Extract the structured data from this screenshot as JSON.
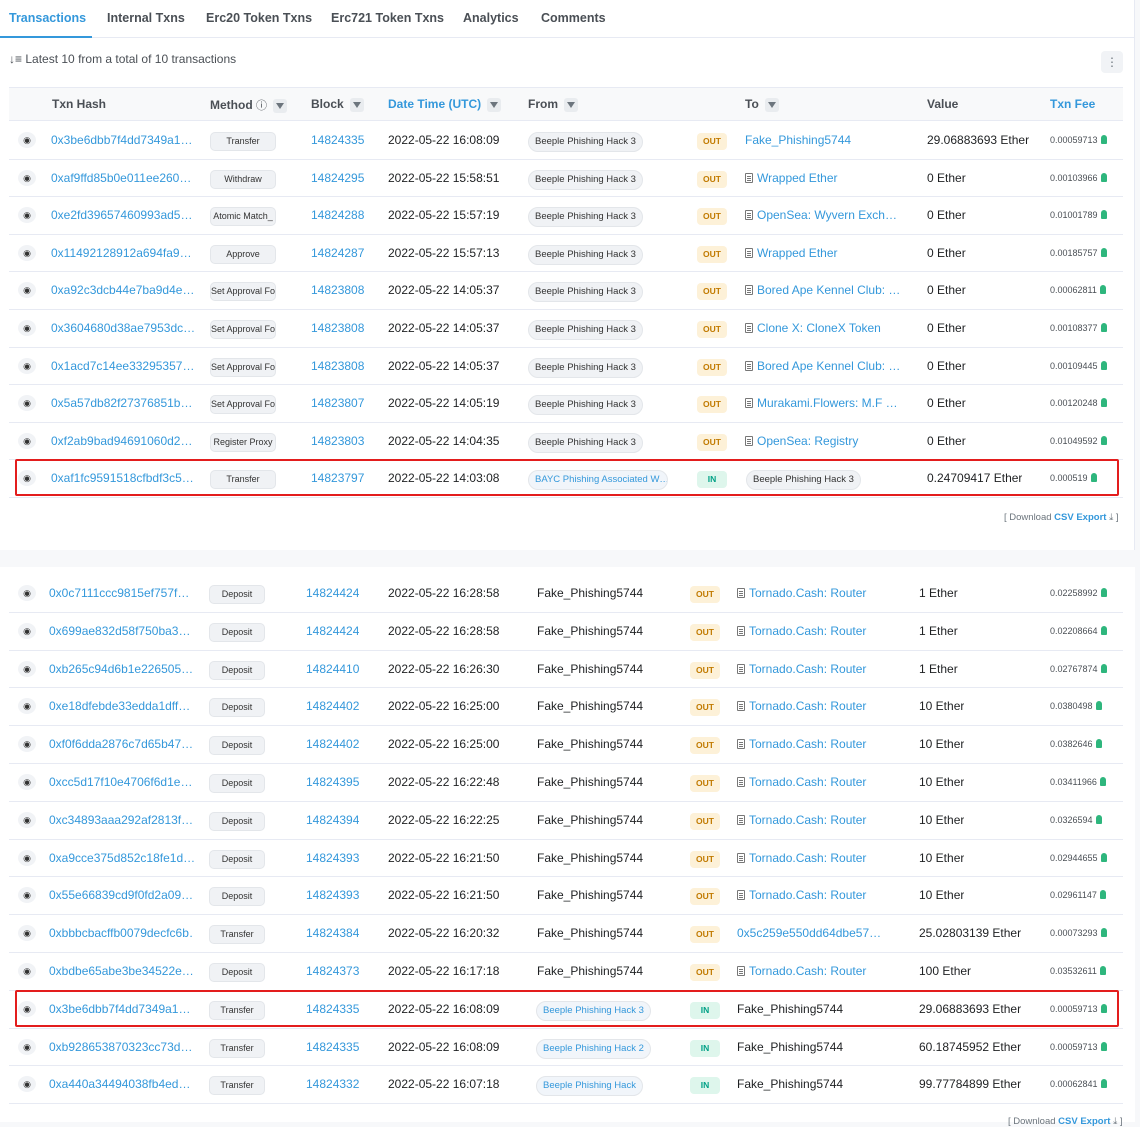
{
  "tabs": [
    "Transactions",
    "Internal Txns",
    "Erc20 Token Txns",
    "Erc721 Token Txns",
    "Analytics",
    "Comments"
  ],
  "summary": "Latest 10 from a total of 10 transactions",
  "headers": {
    "hash": "Txn Hash",
    "method": "Method",
    "block": "Block",
    "date": "Date Time (UTC)",
    "from": "From",
    "to": "To",
    "value": "Value",
    "fee": "Txn Fee"
  },
  "csv": {
    "prefix": "[ Download ",
    "link": "CSV Export",
    "suffix": " ]"
  },
  "table1": [
    {
      "hash": "0x3be6dbb7f4dd7349a1…",
      "method": "Transfer",
      "block": "14824335",
      "date": "2022-05-22 16:08:09",
      "from": "Beeple Phishing Hack 3",
      "dir": "OUT",
      "to": "Fake_Phishing5744",
      "to_contract": false,
      "to_link": true,
      "value": "29.06883693 Ether",
      "fee": "0.00059713"
    },
    {
      "hash": "0xaf9ffd85b0e011ee260…",
      "method": "Withdraw",
      "block": "14824295",
      "date": "2022-05-22 15:58:51",
      "from": "Beeple Phishing Hack 3",
      "dir": "OUT",
      "to": "Wrapped Ether",
      "to_contract": true,
      "to_link": true,
      "value": "0 Ether",
      "fee": "0.00103966"
    },
    {
      "hash": "0xe2fd39657460993ad5…",
      "method": "Atomic Match_",
      "block": "14824288",
      "date": "2022-05-22 15:57:19",
      "from": "Beeple Phishing Hack 3",
      "dir": "OUT",
      "to": "OpenSea: Wyvern Exch…",
      "to_contract": true,
      "to_link": true,
      "value": "0 Ether",
      "fee": "0.01001789"
    },
    {
      "hash": "0x11492128912a694fa9…",
      "method": "Approve",
      "block": "14824287",
      "date": "2022-05-22 15:57:13",
      "from": "Beeple Phishing Hack 3",
      "dir": "OUT",
      "to": "Wrapped Ether",
      "to_contract": true,
      "to_link": true,
      "value": "0 Ether",
      "fee": "0.00185757"
    },
    {
      "hash": "0xa92c3dcb44e7ba9d4e…",
      "method": "Set Approval For…",
      "block": "14823808",
      "date": "2022-05-22 14:05:37",
      "from": "Beeple Phishing Hack 3",
      "dir": "OUT",
      "to": "Bored Ape Kennel Club: …",
      "to_contract": true,
      "to_link": true,
      "value": "0 Ether",
      "fee": "0.00062811"
    },
    {
      "hash": "0x3604680d38ae7953dc…",
      "method": "Set Approval For…",
      "block": "14823808",
      "date": "2022-05-22 14:05:37",
      "from": "Beeple Phishing Hack 3",
      "dir": "OUT",
      "to": "Clone X: CloneX Token",
      "to_contract": true,
      "to_link": true,
      "value": "0 Ether",
      "fee": "0.00108377"
    },
    {
      "hash": "0x1acd7c14ee33295357…",
      "method": "Set Approval For…",
      "block": "14823808",
      "date": "2022-05-22 14:05:37",
      "from": "Beeple Phishing Hack 3",
      "dir": "OUT",
      "to": "Bored Ape Kennel Club: …",
      "to_contract": true,
      "to_link": true,
      "value": "0 Ether",
      "fee": "0.00109445"
    },
    {
      "hash": "0x5a57db82f27376851b…",
      "method": "Set Approval For…",
      "block": "14823807",
      "date": "2022-05-22 14:05:19",
      "from": "Beeple Phishing Hack 3",
      "dir": "OUT",
      "to": "Murakami.Flowers: M.F …",
      "to_contract": true,
      "to_link": true,
      "value": "0 Ether",
      "fee": "0.00120248"
    },
    {
      "hash": "0xf2ab9bad94691060d2…",
      "method": "Register Proxy",
      "block": "14823803",
      "date": "2022-05-22 14:04:35",
      "from": "Beeple Phishing Hack 3",
      "dir": "OUT",
      "to": "OpenSea: Registry",
      "to_contract": true,
      "to_link": true,
      "value": "0 Ether",
      "fee": "0.01049592"
    },
    {
      "hash": "0xaf1fc9591518cfbdf3c5…",
      "method": "Transfer",
      "block": "14823797",
      "date": "2022-05-22 14:03:08",
      "from": "BAYC Phishing Associated W…",
      "from_blue": true,
      "dir": "IN",
      "to": "Beeple Phishing Hack 3",
      "to_tag": true,
      "value": "0.24709417 Ether",
      "fee": "0.000519"
    }
  ],
  "table2": [
    {
      "hash": "0x0c7111ccc9815ef757f…",
      "method": "Deposit",
      "block": "14824424",
      "date": "2022-05-22 16:28:58",
      "from": "Fake_Phishing5744",
      "dir": "OUT",
      "to": "Tornado.Cash: Router",
      "to_contract": true,
      "to_link": true,
      "value": "1 Ether",
      "fee": "0.02258992"
    },
    {
      "hash": "0x699ae832d58f750ba3…",
      "method": "Deposit",
      "block": "14824424",
      "date": "2022-05-22 16:28:58",
      "from": "Fake_Phishing5744",
      "dir": "OUT",
      "to": "Tornado.Cash: Router",
      "to_contract": true,
      "to_link": true,
      "value": "1 Ether",
      "fee": "0.02208664"
    },
    {
      "hash": "0xb265c94d6b1e226505…",
      "method": "Deposit",
      "block": "14824410",
      "date": "2022-05-22 16:26:30",
      "from": "Fake_Phishing5744",
      "dir": "OUT",
      "to": "Tornado.Cash: Router",
      "to_contract": true,
      "to_link": true,
      "value": "1 Ether",
      "fee": "0.02767874"
    },
    {
      "hash": "0xe18dfebde33edda1dff…",
      "method": "Deposit",
      "block": "14824402",
      "date": "2022-05-22 16:25:00",
      "from": "Fake_Phishing5744",
      "dir": "OUT",
      "to": "Tornado.Cash: Router",
      "to_contract": true,
      "to_link": true,
      "value": "10 Ether",
      "fee": "0.0380498"
    },
    {
      "hash": "0xf0f6dda2876c7d65b47…",
      "method": "Deposit",
      "block": "14824402",
      "date": "2022-05-22 16:25:00",
      "from": "Fake_Phishing5744",
      "dir": "OUT",
      "to": "Tornado.Cash: Router",
      "to_contract": true,
      "to_link": true,
      "value": "10 Ether",
      "fee": "0.0382646"
    },
    {
      "hash": "0xcc5d17f10e4706f6d1e…",
      "method": "Deposit",
      "block": "14824395",
      "date": "2022-05-22 16:22:48",
      "from": "Fake_Phishing5744",
      "dir": "OUT",
      "to": "Tornado.Cash: Router",
      "to_contract": true,
      "to_link": true,
      "value": "10 Ether",
      "fee": "0.03411966"
    },
    {
      "hash": "0xc34893aaa292af2813f…",
      "method": "Deposit",
      "block": "14824394",
      "date": "2022-05-22 16:22:25",
      "from": "Fake_Phishing5744",
      "dir": "OUT",
      "to": "Tornado.Cash: Router",
      "to_contract": true,
      "to_link": true,
      "value": "10 Ether",
      "fee": "0.0326594"
    },
    {
      "hash": "0xa9cce375d852c18fe1d…",
      "method": "Deposit",
      "block": "14824393",
      "date": "2022-05-22 16:21:50",
      "from": "Fake_Phishing5744",
      "dir": "OUT",
      "to": "Tornado.Cash: Router",
      "to_contract": true,
      "to_link": true,
      "value": "10 Ether",
      "fee": "0.02944655"
    },
    {
      "hash": "0x55e66839cd9f0fd2a09…",
      "method": "Deposit",
      "block": "14824393",
      "date": "2022-05-22 16:21:50",
      "from": "Fake_Phishing5744",
      "dir": "OUT",
      "to": "Tornado.Cash: Router",
      "to_contract": true,
      "to_link": true,
      "value": "10 Ether",
      "fee": "0.02961147"
    },
    {
      "hash": "0xbbbcbacffb0079decfc6b…",
      "method": "Transfer",
      "block": "14824384",
      "date": "2022-05-22 16:20:32",
      "from": "Fake_Phishing5744",
      "dir": "OUT",
      "to": "0x5c259e550dd64dbe57…",
      "to_contract": false,
      "to_link": true,
      "value": "25.02803139 Ether",
      "fee": "0.00073293"
    },
    {
      "hash": "0xbdbe65abe3be34522e…",
      "method": "Deposit",
      "block": "14824373",
      "date": "2022-05-22 16:17:18",
      "from": "Fake_Phishing5744",
      "dir": "OUT",
      "to": "Tornado.Cash: Router",
      "to_contract": true,
      "to_link": true,
      "value": "100 Ether",
      "fee": "0.03532611"
    },
    {
      "hash": "0x3be6dbb7f4dd7349a1…",
      "method": "Transfer",
      "block": "14824335",
      "date": "2022-05-22 16:08:09",
      "from": "Beeple Phishing Hack 3",
      "from_tag": true,
      "dir": "IN",
      "to": "Fake_Phishing5744",
      "to_contract": false,
      "to_link": false,
      "value": "29.06883693 Ether",
      "fee": "0.00059713"
    },
    {
      "hash": "0xb928653870323cc73d…",
      "method": "Transfer",
      "block": "14824335",
      "date": "2022-05-22 16:08:09",
      "from": "Beeple Phishing Hack 2",
      "from_tag": true,
      "dir": "IN",
      "to": "Fake_Phishing5744",
      "to_contract": false,
      "to_link": false,
      "value": "60.18745952 Ether",
      "fee": "0.00059713"
    },
    {
      "hash": "0xa440a34494038fb4ed…",
      "method": "Transfer",
      "block": "14824332",
      "date": "2022-05-22 16:07:18",
      "from": "Beeple Phishing Hack",
      "from_tag": true,
      "dir": "IN",
      "to": "Fake_Phishing5744",
      "to_contract": false,
      "to_link": false,
      "value": "99.77784899 Ether",
      "fee": "0.00062841"
    }
  ]
}
